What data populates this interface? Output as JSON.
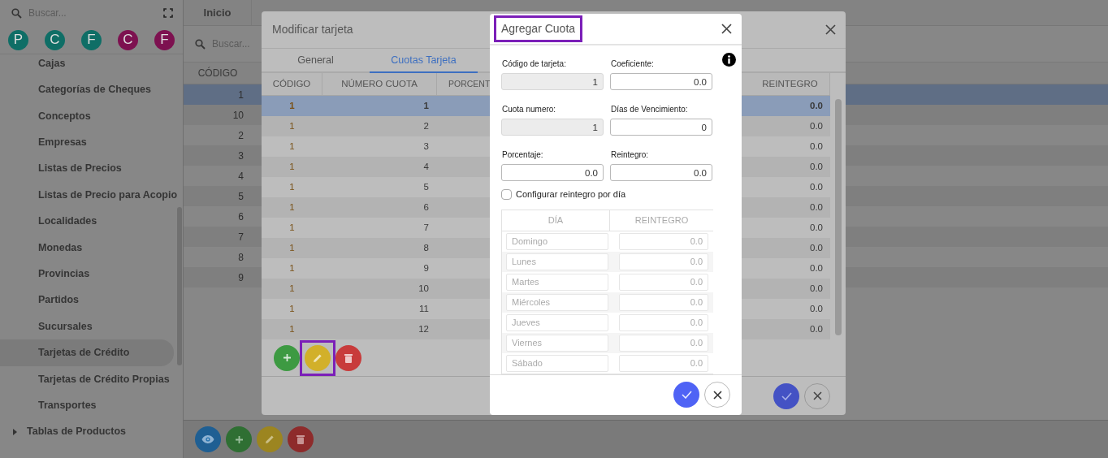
{
  "sidebar": {
    "search": {
      "placeholder": "Buscar..."
    },
    "shortcuts": [
      {
        "letter": "P",
        "color": "#0f6e66"
      },
      {
        "letter": "C",
        "color": "#0f6e66"
      },
      {
        "letter": "F",
        "color": "#0f6e66"
      },
      {
        "letter": "C",
        "color": "#7d1150"
      },
      {
        "letter": "F",
        "color": "#7d1150"
      }
    ],
    "items": [
      {
        "kind": "item",
        "label": "Cajas",
        "selected": false
      },
      {
        "kind": "item",
        "label": "Categorías de Cheques",
        "selected": false
      },
      {
        "kind": "item",
        "label": "Conceptos",
        "selected": false
      },
      {
        "kind": "item",
        "label": "Empresas",
        "selected": false
      },
      {
        "kind": "item",
        "label": "Listas de Precios",
        "selected": false
      },
      {
        "kind": "item",
        "label": "Listas de Precio para Acopio",
        "selected": false
      },
      {
        "kind": "item",
        "label": "Localidades",
        "selected": false
      },
      {
        "kind": "item",
        "label": "Monedas",
        "selected": false
      },
      {
        "kind": "item",
        "label": "Provincias",
        "selected": false
      },
      {
        "kind": "item",
        "label": "Partidos",
        "selected": false
      },
      {
        "kind": "item",
        "label": "Sucursales",
        "selected": false
      },
      {
        "kind": "item",
        "label": "Tarjetas de Crédito",
        "selected": true
      },
      {
        "kind": "item",
        "label": "Tarjetas de Crédito Propias",
        "selected": false
      },
      {
        "kind": "item",
        "label": "Transportes",
        "selected": false
      },
      {
        "kind": "group",
        "label": "Tablas de Productos",
        "selected": false
      }
    ]
  },
  "main": {
    "tabs": [
      {
        "label": "Inicio",
        "selected": false
      }
    ],
    "search": {
      "placeholder": "Buscar..."
    },
    "table": {
      "columns": [
        "CÓDIGO"
      ],
      "rows": [
        {
          "code": "1",
          "selected": true
        },
        {
          "code": "10",
          "selected": false
        },
        {
          "code": "2",
          "selected": false
        },
        {
          "code": "3",
          "selected": false
        },
        {
          "code": "4",
          "selected": false
        },
        {
          "code": "5",
          "selected": false
        },
        {
          "code": "6",
          "selected": false
        },
        {
          "code": "7",
          "selected": false
        },
        {
          "code": "8",
          "selected": false
        },
        {
          "code": "9",
          "selected": false
        }
      ]
    },
    "toolbar": [
      {
        "kind": "view"
      },
      {
        "kind": "add"
      },
      {
        "kind": "edit"
      },
      {
        "kind": "delete"
      }
    ]
  },
  "modify_dialog": {
    "title": "Modificar tarjeta",
    "tabs": [
      {
        "label": "General",
        "selected": false
      },
      {
        "label": "Cuotas Tarjeta",
        "selected": true
      }
    ],
    "table": {
      "columns": [
        "CÓDIGO",
        "NÚMERO CUOTA",
        "PORCENT",
        "REINTEGRO"
      ],
      "rows": [
        {
          "code": "1",
          "number": "1",
          "refund": "0.0",
          "selected": true
        },
        {
          "code": "1",
          "number": "2",
          "refund": "0.0",
          "selected": false
        },
        {
          "code": "1",
          "number": "3",
          "refund": "0.0",
          "selected": false
        },
        {
          "code": "1",
          "number": "4",
          "refund": "0.0",
          "selected": false
        },
        {
          "code": "1",
          "number": "5",
          "refund": "0.0",
          "selected": false
        },
        {
          "code": "1",
          "number": "6",
          "refund": "0.0",
          "selected": false
        },
        {
          "code": "1",
          "number": "7",
          "refund": "0.0",
          "selected": false
        },
        {
          "code": "1",
          "number": "8",
          "refund": "0.0",
          "selected": false
        },
        {
          "code": "1",
          "number": "9",
          "refund": "0.0",
          "selected": false
        },
        {
          "code": "1",
          "number": "10",
          "refund": "0.0",
          "selected": false
        },
        {
          "code": "1",
          "number": "11",
          "refund": "0.0",
          "selected": false
        },
        {
          "code": "1",
          "number": "12",
          "refund": "0.0",
          "selected": false
        }
      ]
    },
    "actions": [
      {
        "kind": "add",
        "highlighted": false
      },
      {
        "kind": "edit",
        "highlighted": true
      },
      {
        "kind": "delete",
        "highlighted": false
      }
    ],
    "footer": [
      {
        "kind": "confirm"
      },
      {
        "kind": "cancel"
      }
    ]
  },
  "add_dialog": {
    "title": "Agregar Cuota",
    "title_highlighted": true,
    "fields": [
      {
        "label": "Código de tarjeta:",
        "value": "1",
        "readonly": true
      },
      {
        "label": "Coeficiente:",
        "value": "0.0",
        "readonly": false
      },
      {
        "label": "Cuota numero:",
        "value": "1",
        "readonly": true
      },
      {
        "label": "Días de Vencimiento:",
        "value": "0",
        "readonly": false
      },
      {
        "label": "Porcentaje:",
        "value": "0.0",
        "readonly": false
      },
      {
        "label": "Reintegro:",
        "value": "0.0",
        "readonly": false
      }
    ],
    "per_day": {
      "label": "Configurar reintegro por día",
      "checked": false
    },
    "day_table": {
      "columns": [
        "DÍA",
        "REINTEGRO"
      ],
      "rows": [
        {
          "day": "Domingo",
          "value": "0.0",
          "disabled": true
        },
        {
          "day": "Lunes",
          "value": "0.0",
          "disabled": true
        },
        {
          "day": "Martes",
          "value": "0.0",
          "disabled": true
        },
        {
          "day": "Miércoles",
          "value": "0.0",
          "disabled": true
        },
        {
          "day": "Jueves",
          "value": "0.0",
          "disabled": true
        },
        {
          "day": "Viernes",
          "value": "0.0",
          "disabled": true
        },
        {
          "day": "Sábado",
          "value": "0.0",
          "disabled": true
        }
      ]
    },
    "footer": [
      {
        "kind": "confirm"
      },
      {
        "kind": "cancel"
      }
    ]
  }
}
